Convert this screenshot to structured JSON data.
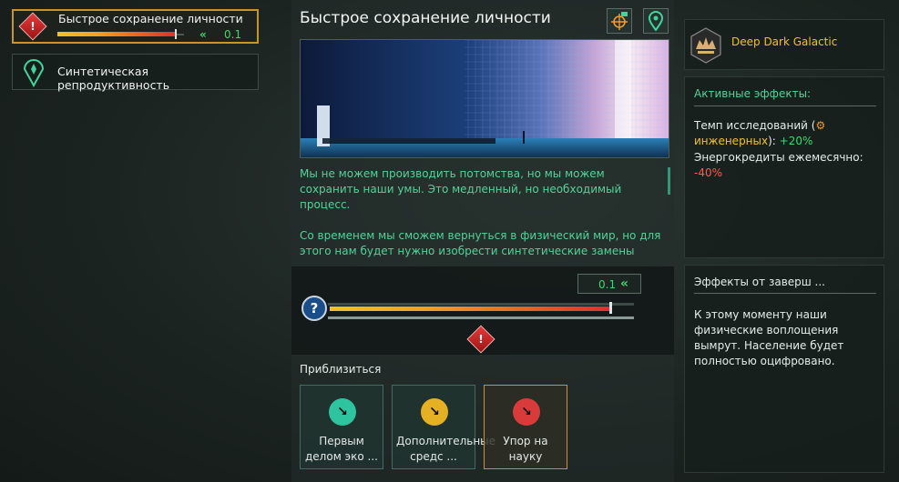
{
  "sidebar": {
    "items": [
      {
        "title": "Быстрое сохранение личности",
        "value": "0.1",
        "icon": "warning-diamond-icon",
        "progress": 0.93,
        "selected": true
      },
      {
        "title": "Синтетическая репродуктивность",
        "icon": "synthetic-marker-icon",
        "selected": false
      }
    ]
  },
  "main": {
    "title": "Быстрое сохранение личности",
    "description": [
      "Мы не можем производить потомства, но мы можем сохранить наши умы. Это медленный, но необходимый процесс.",
      "Со временем мы сможем вернуться в физический мир, но для этого нам будет нужно изобрести синтетические замены"
    ],
    "slider": {
      "value": "0.1",
      "help_label": "?",
      "level": 0.93
    },
    "approach_label": "Приблизиться",
    "approaches": [
      {
        "label": "Первым делом эко ...",
        "color": "#2ec4a0"
      },
      {
        "label": "Дополнительные средс ...",
        "color": "#e6b025"
      },
      {
        "label": "Упор на науку",
        "color": "#d93a3a",
        "selected": true
      }
    ]
  },
  "right": {
    "empire_name": "Deep Dark Galactic",
    "active_effects": {
      "header": "Активные эффекты:",
      "line1_prefix": "Темп исследований (",
      "line1_highlight": "инженерных",
      "line1_suffix": "): ",
      "line1_value": "+20%",
      "line2": "Энергокредиты ежемесячно:",
      "line2_value": "-40%"
    },
    "completion": {
      "header": "Эффекты от заверш ...",
      "text": "К этому моменту наши физические воплощения вымрут. Население будет полностью оцифровано."
    }
  },
  "colors": {
    "accent_gold": "#c9952a",
    "accent_green": "#52d39a",
    "danger_red": "#e0302a"
  }
}
